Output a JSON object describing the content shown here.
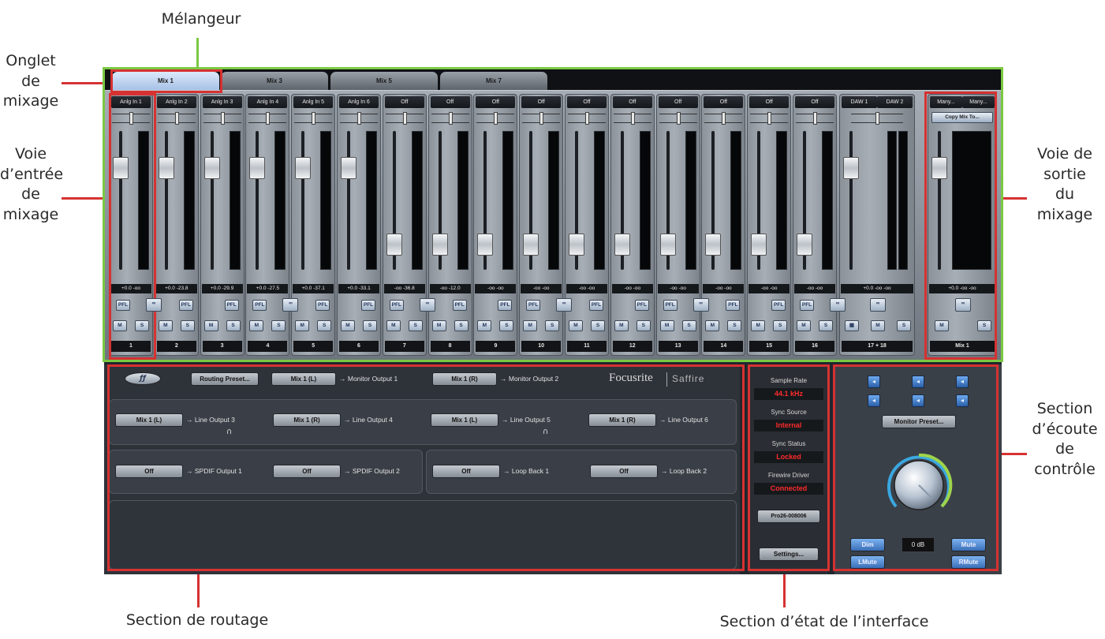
{
  "annotations": {
    "melangeur": "Mélangeur",
    "onglet_line1": "Onglet",
    "onglet_line2": "de",
    "onglet_line3": "mixage",
    "voie_entree_line1": "Voie",
    "voie_entree_line2": "d’entrée",
    "voie_entree_line3": "de",
    "voie_entree_line4": "mixage",
    "voie_sortie_line1": "Voie de",
    "voie_sortie_line2": "sortie",
    "voie_sortie_line3": "du",
    "voie_sortie_line4": "mixage",
    "ecoute_line1": "Section",
    "ecoute_line2": "d’écoute",
    "ecoute_line3": "de",
    "ecoute_line4": "contrôle",
    "routage": "Section de routage",
    "etat": "Section d’état de l’interface"
  },
  "tabs": [
    "Mix 1",
    "Mix 3",
    "Mix 5",
    "Mix 7"
  ],
  "channels": [
    {
      "name": "Anlg In 1",
      "vals": "+0.0  -oo",
      "num": "1",
      "fader": 0.78
    },
    {
      "name": "Anlg In 2",
      "vals": "+0.0 -23.8",
      "num": "2",
      "fader": 0.78
    },
    {
      "name": "Anlg In 3",
      "vals": "+0.0 -29.9",
      "num": "3",
      "fader": 0.78
    },
    {
      "name": "Anlg In 4",
      "vals": "+0.0 -27.5",
      "num": "4",
      "fader": 0.78
    },
    {
      "name": "Anlg In 5",
      "vals": "+0.0 -37.1",
      "num": "5",
      "fader": 0.78
    },
    {
      "name": "Anlg In 6",
      "vals": "+0.0 -33.1",
      "num": "6",
      "fader": 0.78
    },
    {
      "name": "Off",
      "vals": "-oo -36.8",
      "num": "7",
      "fader": 0.12
    },
    {
      "name": "Off",
      "vals": "-oo -12.0",
      "num": "8",
      "fader": 0.12
    },
    {
      "name": "Off",
      "vals": "-oo  -oo",
      "num": "9",
      "fader": 0.12
    },
    {
      "name": "Off",
      "vals": "-oo  -oo",
      "num": "10",
      "fader": 0.12
    },
    {
      "name": "Off",
      "vals": "-oo  -oo",
      "num": "11",
      "fader": 0.12
    },
    {
      "name": "Off",
      "vals": "-oo  -oo",
      "num": "12",
      "fader": 0.12
    },
    {
      "name": "Off",
      "vals": "-oo  -oo",
      "num": "13",
      "fader": 0.12
    },
    {
      "name": "Off",
      "vals": "-oo  -oo",
      "num": "14",
      "fader": 0.12
    },
    {
      "name": "Off",
      "vals": "-oo  -oo",
      "num": "15",
      "fader": 0.12
    },
    {
      "name": "Off",
      "vals": "-oo  -oo",
      "num": "16",
      "fader": 0.12
    }
  ],
  "daw": {
    "name1": "DAW 1",
    "name2": "DAW 2",
    "vals": "+0.0  -oo  -oo",
    "num": "17 + 18",
    "fader": 0.78
  },
  "mixout": {
    "name1": "Many...",
    "name2": "Many...",
    "copy": "Copy Mix To...",
    "vals": "+0.0  -oo  -oo",
    "num": "Mix 1",
    "fader": 0.78
  },
  "buttons": {
    "pfl": "PFL",
    "link": "∞",
    "mute": "M",
    "solo": "S"
  },
  "routing": {
    "preset": "Routing Preset...",
    "mon1_src": "Mix 1 (L)",
    "mon1_dst": "→ Monitor Output 1",
    "mon2_src": "Mix 1 (R)",
    "mon2_dst": "→ Monitor Output 2",
    "brand": "Focusrite",
    "product": "Saffire",
    "line3_src": "Mix 1 (L)",
    "line3_dst": "→ Line Output 3",
    "line4_src": "Mix 1 (R)",
    "line4_dst": "→ Line Output 4",
    "line5_src": "Mix 1 (L)",
    "line5_dst": "→ Line Output 5",
    "line6_src": "Mix 1 (R)",
    "line6_dst": "→ Line Output 6",
    "spdif1_src": "Off",
    "spdif1_dst": "→ SPDIF Output 1",
    "spdif2_src": "Off",
    "spdif2_dst": "→ SPDIF Output 2",
    "lb1_src": "Off",
    "lb1_dst": "→ Loop Back 1",
    "lb2_src": "Off",
    "lb2_dst": "→ Loop Back 2"
  },
  "status": {
    "sr_label": "Sample Rate",
    "sr_value": "44.1 kHz",
    "ss_label": "Sync Source",
    "ss_value": "Internal",
    "sst_label": "Sync Status",
    "sst_value": "Locked",
    "fw_label": "Firewire Driver",
    "fw_value": "Connected",
    "device": "Pro26-008006",
    "settings": "Settings..."
  },
  "monitor": {
    "preset": "Monitor Preset...",
    "dim": "Dim",
    "level": "0 dB",
    "mute": "Mute",
    "lmute": "LMute",
    "rmute": "RMute"
  },
  "colors": {
    "annotation_red": "#d63232",
    "annotation_green": "#7ac943",
    "status_red": "#ff2a2a"
  }
}
